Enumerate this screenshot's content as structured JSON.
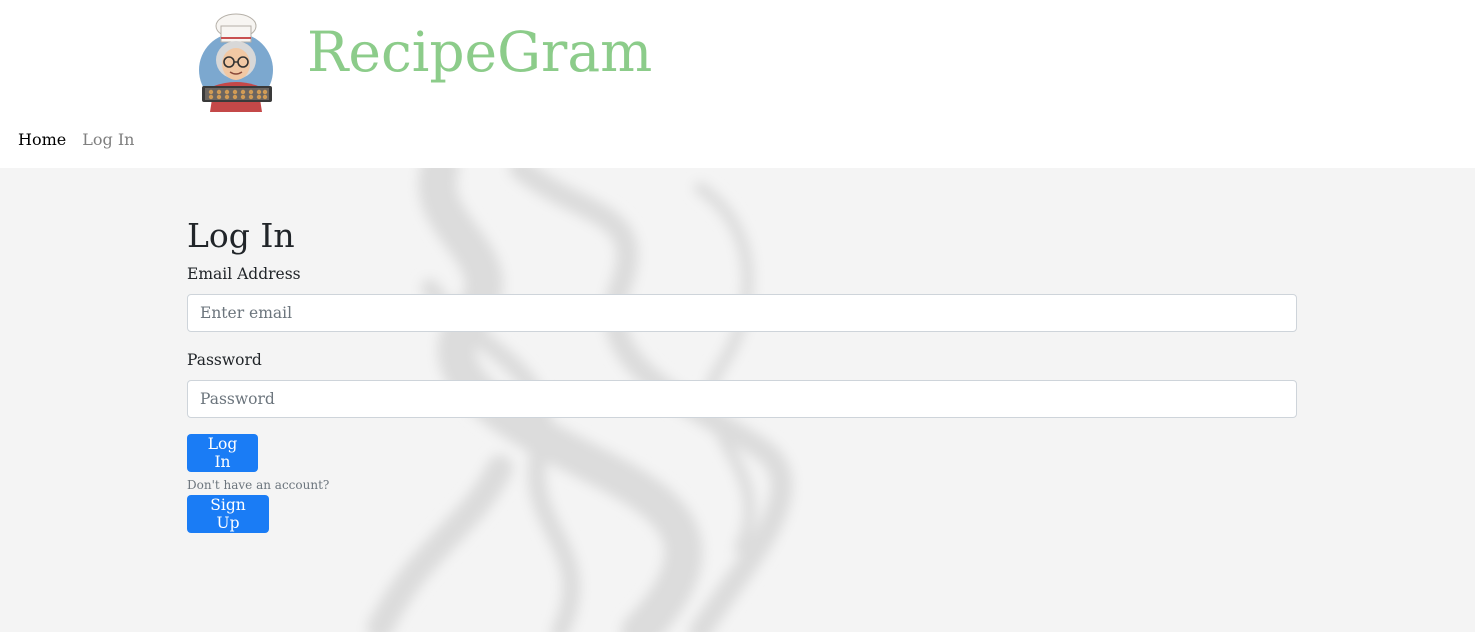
{
  "brand": {
    "name": "RecipeGram",
    "logo_icon": "chef-grandma-logo-icon",
    "brand_color": "#8ccc8a"
  },
  "nav": {
    "home_label": "Home",
    "login_label": "Log In"
  },
  "login_form": {
    "title": "Log In",
    "email_label": "Email Address",
    "email_placeholder": "Enter email",
    "email_value": "",
    "password_label": "Password",
    "password_placeholder": "Password",
    "password_value": "",
    "submit_label": "Log In",
    "no_account_text": "Don't have an account?",
    "signup_label": "Sign Up"
  },
  "colors": {
    "accent": "#1a7cf5",
    "content_background": "#f4f4f4"
  }
}
